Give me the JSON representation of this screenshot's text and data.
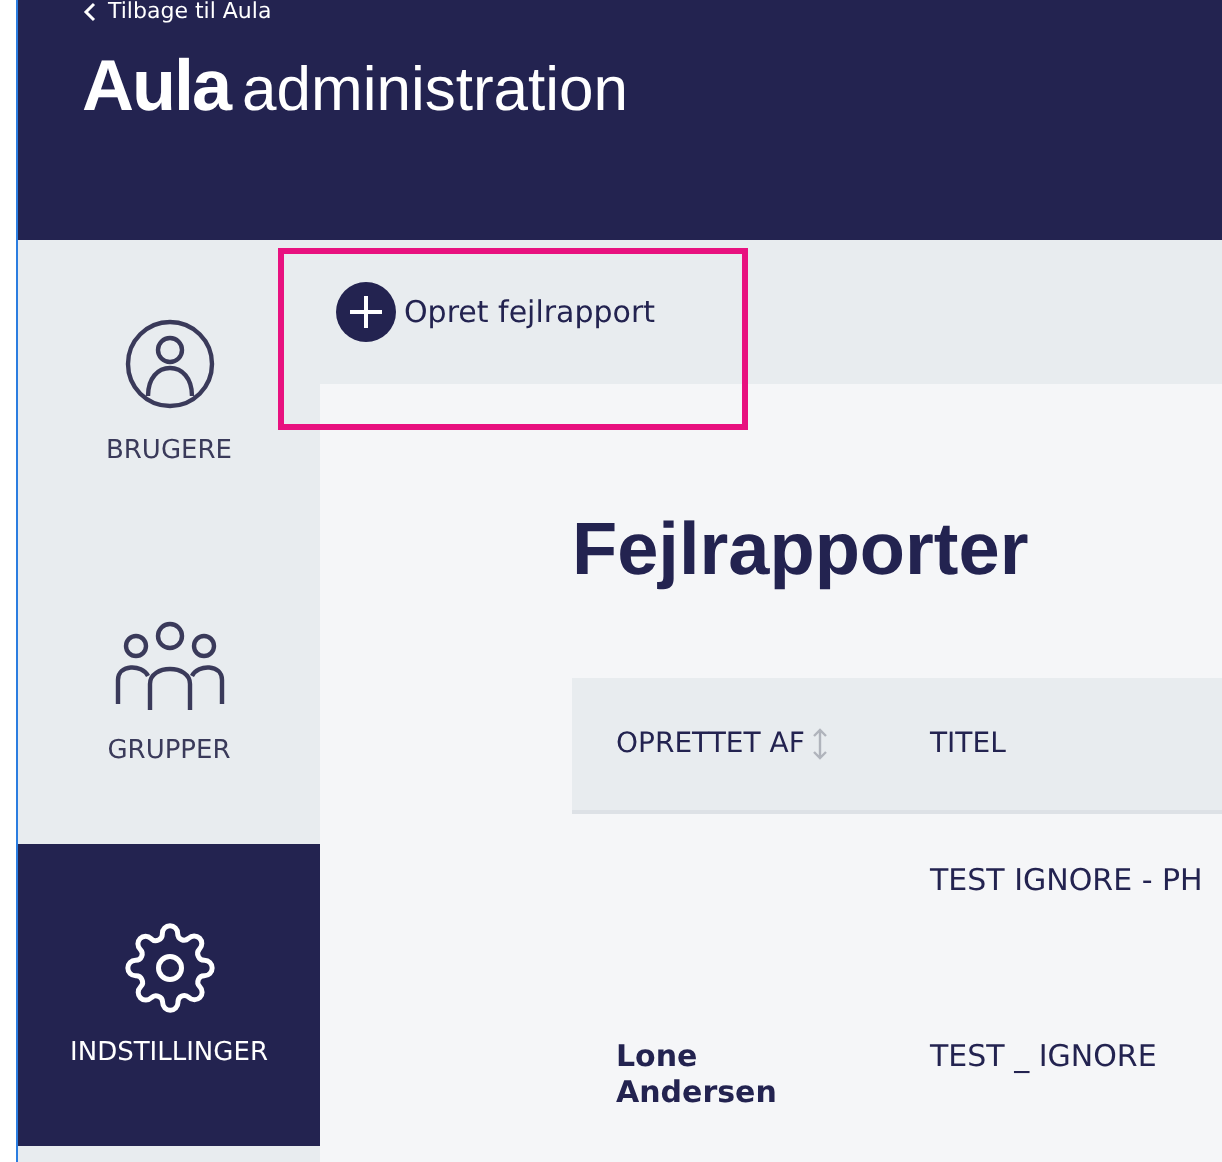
{
  "header": {
    "back_link": "Tilbage til Aula",
    "logo": "Aula",
    "title": "administration"
  },
  "sidebar": {
    "items": [
      {
        "label": "BRUGERE",
        "kind": "user",
        "selected": false
      },
      {
        "label": "GRUPPER",
        "kind": "group",
        "selected": false
      },
      {
        "label": "INDSTILLINGER",
        "kind": "gear",
        "selected": true
      }
    ]
  },
  "toolbar": {
    "create_button": "Opret fejlrapport",
    "highlighted": true
  },
  "page_title": "Fejlrapporter",
  "table": {
    "columns": [
      {
        "label": "OPRETTET AF",
        "sortable": true
      },
      {
        "label": "TITEL",
        "sortable": false
      }
    ],
    "rows": [
      [
        "",
        "TEST IGNORE - PH"
      ],
      [
        "Lone Andersen",
        "TEST _ IGNORE"
      ]
    ]
  }
}
